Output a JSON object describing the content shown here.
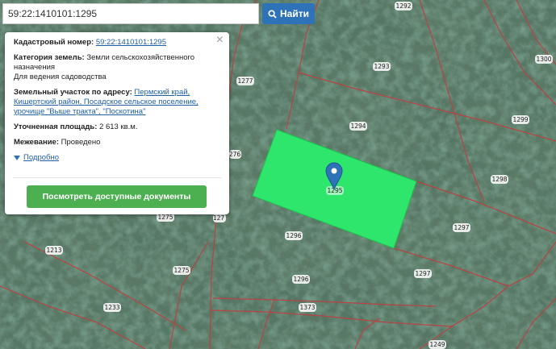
{
  "search": {
    "value": "59:22:1410101:1295",
    "button_label": "Найти"
  },
  "popup": {
    "cadastral_label": "Кадастровый номер:",
    "cadastral_value": "59:22:1410101:1295",
    "category_label": "Категория земель:",
    "category_value_line1": "Земли сельскохозяйственного",
    "category_value_line2": "назначения",
    "use": "Для ведения садоводства",
    "address_label": "Земельный участок по адресу:",
    "address_line1": "Пермский край,",
    "address_line2": "Кишертский район, Посадское сельское поселение,",
    "address_line3": "урочище \"Выше тракта\", \"Поскотина\"",
    "area_label": "Уточненная площадь:",
    "area_value": "2 613 кв.м.",
    "survey_label": "Межевание:",
    "survey_value": "Проведено",
    "more_link": "Подробно",
    "docs_button": "Посмотреть доступные документы",
    "close_symbol": "×"
  },
  "map": {
    "highlight_color": "#2ee66b",
    "boundary_color": "#b84343",
    "parcel_labels": [
      {
        "id": "p1292",
        "text": "1292"
      },
      {
        "id": "p1300",
        "text": "1300"
      },
      {
        "id": "p1293",
        "text": "1293"
      },
      {
        "id": "p1277",
        "text": "1277"
      },
      {
        "id": "p1294",
        "text": "1294"
      },
      {
        "id": "p1299",
        "text": "1299"
      },
      {
        "id": "p1276",
        "text": "276"
      },
      {
        "id": "p1298",
        "text": "1298"
      },
      {
        "id": "p1295",
        "text": "1295"
      },
      {
        "id": "p1275a",
        "text": "1275"
      },
      {
        "id": "p1274",
        "text": "127"
      },
      {
        "id": "p1296a",
        "text": "1296"
      },
      {
        "id": "p1297a",
        "text": "1297"
      },
      {
        "id": "p1213",
        "text": "1213"
      },
      {
        "id": "p1275b",
        "text": "1275"
      },
      {
        "id": "p1296b",
        "text": "1296"
      },
      {
        "id": "p1297b",
        "text": "1297"
      },
      {
        "id": "p1233",
        "text": "1233"
      },
      {
        "id": "p1373",
        "text": "1373"
      },
      {
        "id": "p1249",
        "text": "1249"
      }
    ]
  }
}
